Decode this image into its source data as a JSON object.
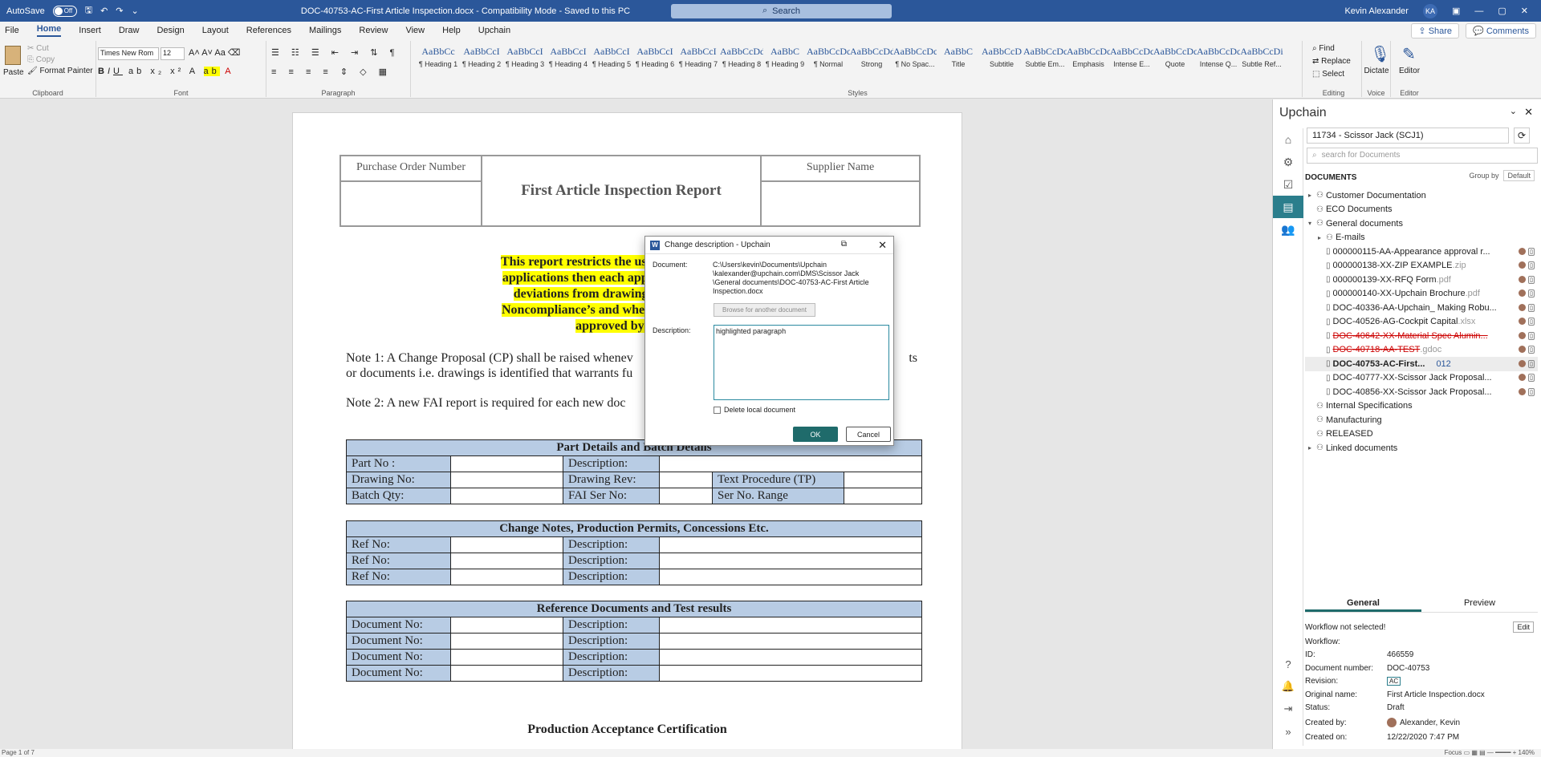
{
  "titlebar": {
    "autosave_label": "AutoSave",
    "autosave_state": "Off",
    "doc_title": "DOC-40753-AC-First Article Inspection.docx  -  Compatibility Mode  -  Saved to this PC",
    "search_placeholder": "Search",
    "user_name": "Kevin Alexander",
    "user_initials": "KA"
  },
  "menu": {
    "items": [
      "File",
      "Home",
      "Insert",
      "Draw",
      "Design",
      "Layout",
      "References",
      "Mailings",
      "Review",
      "View",
      "Help",
      "Upchain"
    ],
    "share": "Share",
    "comments": "Comments"
  },
  "ribbon": {
    "clipboard": {
      "label": "Clipboard",
      "paste": "Paste",
      "cut": "Cut",
      "copy": "Copy",
      "format_painter": "Format Painter"
    },
    "font": {
      "label": "Font",
      "name": "Times New Rom",
      "size": "12"
    },
    "paragraph": {
      "label": "Paragraph"
    },
    "styles": {
      "label": "Styles",
      "items": [
        {
          "big": "AaBbCc",
          "small": "¶ Heading 1"
        },
        {
          "big": "AaBbCcI",
          "small": "¶ Heading 2"
        },
        {
          "big": "AaBbCcI",
          "small": "¶ Heading 3"
        },
        {
          "big": "AaBbCcI",
          "small": "¶ Heading 4"
        },
        {
          "big": "AaBbCcI",
          "small": "¶ Heading 5"
        },
        {
          "big": "AaBbCcI",
          "small": "¶ Heading 6"
        },
        {
          "big": "AaBbCcI",
          "small": "¶ Heading 7"
        },
        {
          "big": "AaBbCcDd",
          "small": "¶ Heading 8"
        },
        {
          "big": "AaBbC",
          "small": "¶ Heading 9"
        },
        {
          "big": "AaBbCcDc",
          "small": "¶ Normal"
        },
        {
          "big": "AaBbCcDd",
          "small": "Strong"
        },
        {
          "big": "AaBbCcDc",
          "small": "¶ No Spac..."
        },
        {
          "big": "AaBbC",
          "small": "Title"
        },
        {
          "big": "AaBbCcD",
          "small": "Subtitle"
        },
        {
          "big": "AaBbCcDc",
          "small": "Subtle Em..."
        },
        {
          "big": "AaBbCcDc",
          "small": "Emphasis"
        },
        {
          "big": "AaBbCcDc",
          "small": "Intense E..."
        },
        {
          "big": "AaBbCcDc",
          "small": "Quote"
        },
        {
          "big": "AaBbCcDc",
          "small": "Intense Q..."
        },
        {
          "big": "AaBbCcDi",
          "small": "Subtle Ref..."
        }
      ]
    },
    "editing": {
      "label": "Editing",
      "find": "Find",
      "replace": "Replace",
      "select": "Select"
    },
    "voice": {
      "label": "Voice",
      "dictate": "Dictate"
    },
    "editor": {
      "label": "Editor",
      "editor": "Editor"
    }
  },
  "document": {
    "po_number": "Purchase Order Number",
    "report_title": "First Article Inspection Report",
    "supplier_name": "Supplier Name",
    "warning_lines": [
      "This report restricts the use of a single part in a s",
      "applications then each application shall have a F",
      "deviations from drawings shall be highlighte",
      "Noncompliance’s and where applicable a Reques",
      "approved by CDNZ p"
    ],
    "note1_line1": "Note 1: A Change Proposal (CP) shall be raised whenev",
    "note1_line1_end": "ts",
    "note1_line2": "or documents i.e. drawings is identified that warrants fu",
    "note2": "Note 2: A new FAI report is required for each new doc",
    "part_table": {
      "title": "Part Details and Batch Details",
      "part_no": "Part No :",
      "description": "Description:",
      "drawing_no": "Drawing No:",
      "drawing_rev": "Drawing Rev:",
      "text_procedure": "Text Procedure (TP)",
      "batch_qty": "Batch Qty:",
      "fai_ser": "FAI Ser No:",
      "ser_range": "Ser No. Range"
    },
    "change_table": {
      "title": "Change Notes, Production Permits, Concessions Etc.",
      "ref_no": "Ref No:",
      "description": "Description:"
    },
    "ref_table": {
      "title": "Reference Documents and Test results",
      "doc_no": "Document No:",
      "description": "Description:"
    },
    "cert_title": "Production Acceptance Certification"
  },
  "dialog": {
    "title": "Change description - Upchain",
    "doc_label": "Document:",
    "doc_path": "C:\\Users\\kevin\\Documents\\Upchain \\kalexander@upchain.com\\DMS\\Scissor Jack \\General documents\\DOC-40753-AC-First Article Inspection.docx",
    "browse": "Browse for another document",
    "desc_label": "Description:",
    "desc_value": "highlighted paragraph",
    "delete_local": "Delete local document",
    "ok": "OK",
    "cancel": "Cancel"
  },
  "panel": {
    "title": "Upchain",
    "project": "11734 - Scissor Jack (SCJ1)",
    "search_placeholder": "search for Documents",
    "documents_label": "DOCUMENTS",
    "group_by_label": "Group by",
    "group_by_value": "Default",
    "tree": [
      {
        "name": "Customer Documentation",
        "ext": ""
      },
      {
        "name": "ECO Documents",
        "ext": ""
      },
      {
        "name": "General documents",
        "ext": ""
      },
      {
        "name": "E-mails",
        "ext": ""
      },
      {
        "name": "000000115-AA-Appearance approval r...",
        "ext": ""
      },
      {
        "name": "000000138-XX-ZIP EXAMPLE",
        "ext": ".zip"
      },
      {
        "name": "000000139-XX-RFQ Form",
        "ext": ".pdf"
      },
      {
        "name": "000000140-XX-Upchain Brochure",
        "ext": ".pdf"
      },
      {
        "name": "DOC-40336-AA-Upchain_ Making Robu...",
        "ext": ""
      },
      {
        "name": "DOC-40526-AG-Cockpit Capital",
        "ext": ".xlsx"
      },
      {
        "name": "DOC-40642-XX-Material Spec Alumin...",
        "ext": ""
      },
      {
        "name": "DOC-40718-AA-TEST",
        "ext": ".gdoc"
      },
      {
        "name": "DOC-40753-AC-First...",
        "ext": "",
        "count": "012"
      },
      {
        "name": "DOC-40777-XX-Scissor Jack Proposal...",
        "ext": ""
      },
      {
        "name": "DOC-40856-XX-Scissor Jack Proposal...",
        "ext": ""
      },
      {
        "name": "Internal Specifications",
        "ext": ""
      },
      {
        "name": "Manufacturing",
        "ext": ""
      },
      {
        "name": "RELEASED",
        "ext": ""
      },
      {
        "name": "Linked documents",
        "ext": ""
      }
    ],
    "tabs": {
      "general": "General",
      "preview": "Preview"
    },
    "props": {
      "workflow_msg": "Workflow not selected!",
      "edit": "Edit",
      "workflow_k": "Workflow:",
      "id_k": "ID:",
      "id_v": "466559",
      "docnum_k": "Document number:",
      "docnum_v": "DOC-40753",
      "rev_k": "Revision:",
      "rev_v": "AC",
      "orig_k": "Original name:",
      "orig_v": "First Article Inspection.docx",
      "status_k": "Status:",
      "status_v": "Draft",
      "created_k": "Created by:",
      "created_v": "Alexander, Kevin",
      "createdon_k": "Created on:",
      "createdon_v": "12/22/2020 7:47 PM"
    }
  },
  "status": {
    "page": "Page 1 of 7",
    "focus": "Focus",
    "zoom": "140%"
  }
}
